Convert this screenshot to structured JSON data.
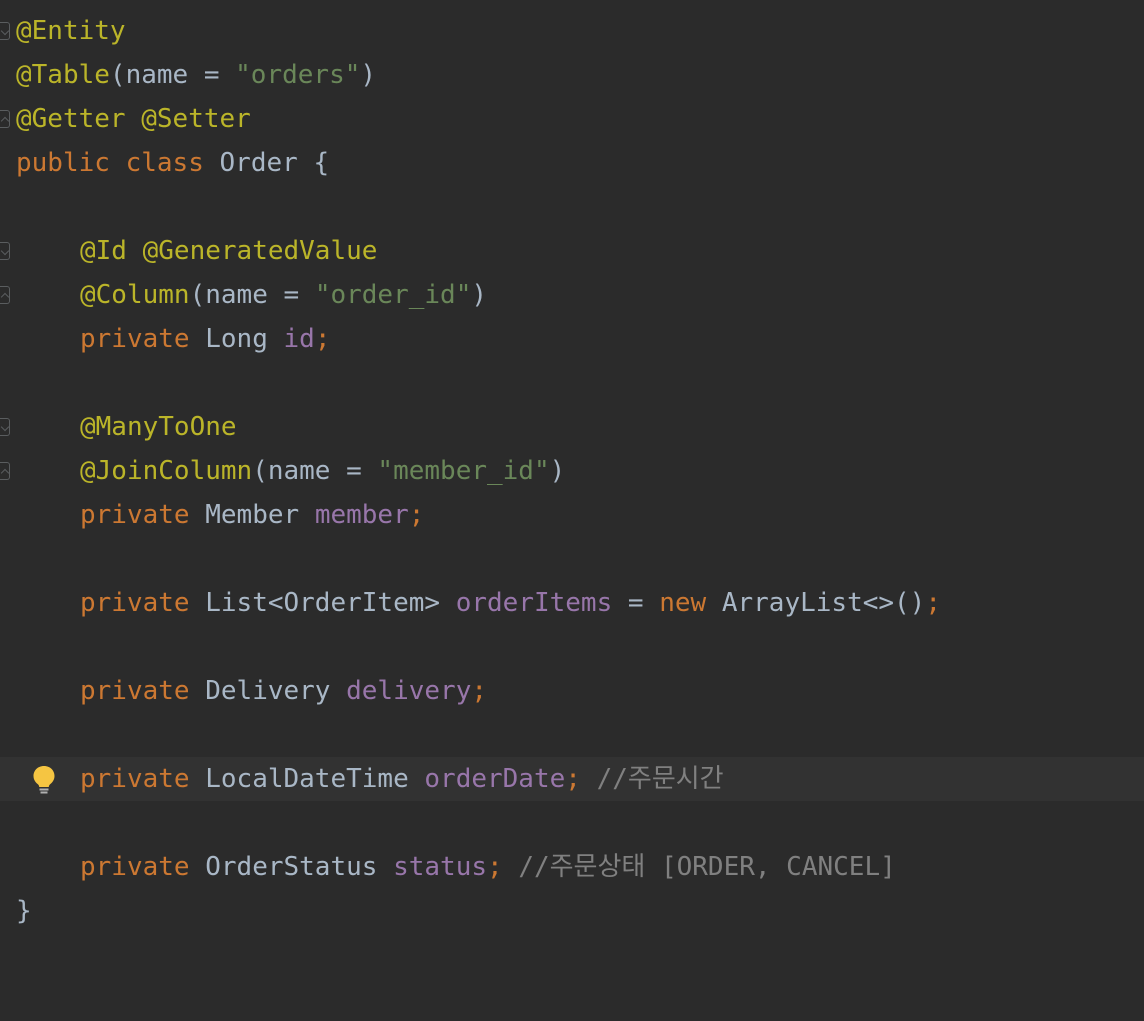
{
  "editor": {
    "lines": [
      {
        "kind": "annotation",
        "text": "@Entity"
      },
      {
        "kind": "annotation-call",
        "ann": "@Table",
        "open": "(",
        "param": "name = ",
        "str": "\"orders\"",
        "close": ")"
      },
      {
        "kind": "annotation-pair",
        "a": "@Getter",
        "b": "@Setter"
      },
      {
        "kind": "class-decl",
        "kw1": "public",
        "kw2": "class",
        "name": "Order",
        "brace": "{"
      },
      {
        "kind": "annotation-pair",
        "a": "@Id",
        "b": "@GeneratedValue"
      },
      {
        "kind": "annotation-call",
        "ann": "@Column",
        "open": "(",
        "param": "name = ",
        "str": "\"order_id\"",
        "close": ")"
      },
      {
        "kind": "field",
        "kw": "private",
        "type": "Long",
        "name": "id",
        "semi": ";"
      },
      {
        "kind": "annotation",
        "text": "@ManyToOne"
      },
      {
        "kind": "annotation-call",
        "ann": "@JoinColumn",
        "open": "(",
        "param": "name = ",
        "str": "\"member_id\"",
        "close": ")"
      },
      {
        "kind": "field",
        "kw": "private",
        "type": "Member",
        "name": "member",
        "semi": ";"
      },
      {
        "kind": "field-init",
        "kw": "private",
        "type": "List<OrderItem>",
        "name": "orderItems",
        "eq": " = ",
        "kwnew": "new",
        "init": "ArrayList<>()",
        "semi": ";"
      },
      {
        "kind": "field",
        "kw": "private",
        "type": "Delivery",
        "name": "delivery",
        "semi": ";"
      },
      {
        "kind": "field-comment",
        "kw": "private",
        "type": "LocalDateTime",
        "name": "orderDate",
        "semi": ";",
        "comment": "//주문시간"
      },
      {
        "kind": "field-comment",
        "kw": "private",
        "type": "OrderStatus",
        "name": "status",
        "semi": ";",
        "comment": "//주문상태 [ORDER, CANCEL]"
      },
      {
        "kind": "close",
        "text": "}"
      }
    ],
    "intention_icon": "lightbulb-icon"
  },
  "colors": {
    "background": "#2b2b2b",
    "annotation": "#bbb529",
    "keyword": "#cc7832",
    "string": "#6a8759",
    "field": "#9876aa",
    "comment": "#808080",
    "text": "#a9b7c6"
  }
}
